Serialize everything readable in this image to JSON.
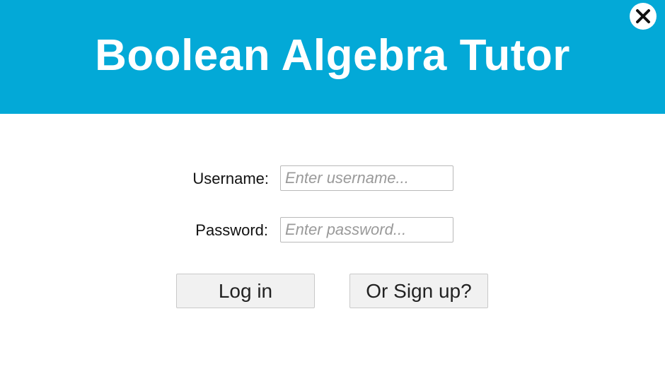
{
  "header": {
    "title": "Boolean Algebra Tutor",
    "background_color": "#03a9d7",
    "close_icon": "close-icon"
  },
  "form": {
    "username": {
      "label": "Username:",
      "value": "",
      "placeholder": "Enter username..."
    },
    "password": {
      "label": "Password:",
      "value": "",
      "placeholder": "Enter password..."
    }
  },
  "actions": {
    "login_label": "Log in",
    "signup_label": "Or Sign up?"
  }
}
